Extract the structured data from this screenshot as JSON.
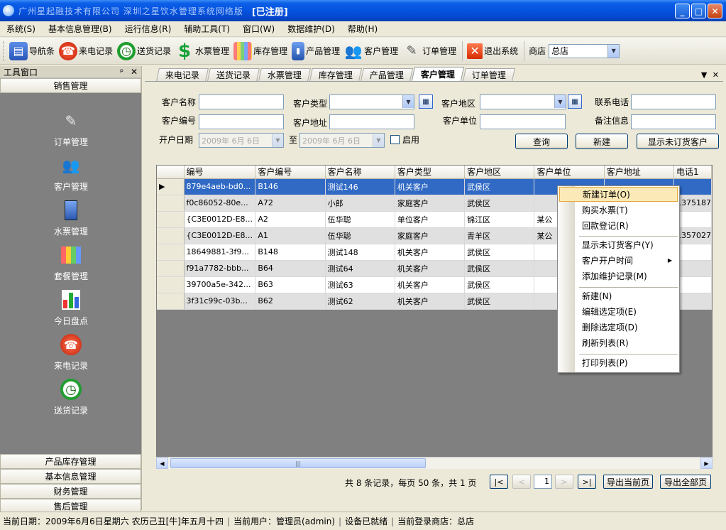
{
  "window": {
    "title_blurred": "广州星起融技术有限公司 深圳之星饮水管理系统网络版",
    "title_tag": "[已注册]"
  },
  "menu": [
    "系统(S)",
    "基本信息管理(B)",
    "运行信息(R)",
    "辅助工具(T)",
    "窗口(W)",
    "数据维护(D)",
    "帮助(H)"
  ],
  "toolbar": {
    "items": [
      "导航条",
      "来电记录",
      "送货记录",
      "水票管理",
      "库存管理",
      "产品管理",
      "客户管理",
      "订单管理",
      "退出系统"
    ],
    "shop_label": "商店",
    "shop_value": "总店"
  },
  "left_panel": {
    "title": "工具窗口",
    "pin": "ᵖ",
    "close": "✕",
    "top_group": "销售管理",
    "nav": [
      "订单管理",
      "客户管理",
      "水票管理",
      "套餐管理",
      "今日盘点",
      "来电记录",
      "送货记录"
    ],
    "bottom_groups": [
      "产品库存管理",
      "基本信息管理",
      "财务管理",
      "售后管理"
    ]
  },
  "tabs": [
    "来电记录",
    "送货记录",
    "水票管理",
    "库存管理",
    "产品管理",
    "客户管理",
    "订单管理"
  ],
  "active_tab": "客户管理",
  "filter": {
    "customer_name": "客户名称",
    "customer_type": "客户类型",
    "customer_region": "客户地区",
    "phone": "联系电话",
    "customer_no": "客户编号",
    "customer_address": "客户地址",
    "customer_unit": "客户单位",
    "remark": "备注信息",
    "open_date": "开户日期",
    "date_from": "2009年 6月 6日",
    "to": "至",
    "date_to": "2009年 6月 6日",
    "enable": "启用",
    "btn_query": "查询",
    "btn_new": "新建",
    "btn_show_no_order": "显示未订货客户"
  },
  "grid": {
    "columns": [
      "编号",
      "客户编号",
      "客户名称",
      "客户类型",
      "客户地区",
      "客户单位",
      "客户地址",
      "电话1"
    ],
    "rows": [
      [
        "879e4aeb-bd0...",
        "B146",
        "测试146",
        "机关客户",
        "武侯区",
        "",
        "",
        ""
      ],
      [
        "f0c86052-80e...",
        "A72",
        "小郎",
        "家庭客户",
        "武侯区",
        "",
        "",
        "1375187"
      ],
      [
        "{C3E0012D-E8...",
        "A2",
        "伍华聪",
        "单位客户",
        "锦江区",
        "某公",
        "",
        ""
      ],
      [
        "{C3E0012D-E8...",
        "A1",
        "伍华聪",
        "家庭客户",
        "青羊区",
        "某公",
        "",
        "1357027"
      ],
      [
        "18649881-3f9...",
        "B148",
        "测试148",
        "机关客户",
        "武侯区",
        "",
        "",
        ""
      ],
      [
        "f91a7782-bbb...",
        "B64",
        "测试64",
        "机关客户",
        "武侯区",
        "",
        "",
        ""
      ],
      [
        "39700a5e-342...",
        "B63",
        "测试63",
        "机关客户",
        "武侯区",
        "",
        "",
        ""
      ],
      [
        "3f31c99c-03b...",
        "B62",
        "测试62",
        "机关客户",
        "武侯区",
        "",
        "",
        ""
      ]
    ]
  },
  "pager": {
    "info": "共 8 条记录，每页 50 条，共 1 页",
    "first": "|<",
    "prev": "<",
    "page": "1",
    "next": ">",
    "last": ">|",
    "export_current": "导出当前页",
    "export_all": "导出全部页"
  },
  "context_menu": {
    "items": [
      "新建订单(O)",
      "购买水票(T)",
      "回款登记(R)",
      "显示未订货客户(Y)",
      "客户开户时间",
      "添加维护记录(M)",
      "新建(N)",
      "编辑选定项(E)",
      "删除选定项(D)",
      "刷新列表(R)",
      "打印列表(P)"
    ]
  },
  "status": {
    "date": "当前日期：2009年6月6日星期六 农历己丑[牛]年五月十四",
    "user": "当前用户：管理员(admin)",
    "device": "设备已就绪",
    "shop": "当前登录商店：总店"
  },
  "colors": {
    "title_bar": "#0553e0",
    "selection": "#316ac5",
    "left_panel_body": "#808080",
    "menu_highlight": "#fbe9b7"
  }
}
